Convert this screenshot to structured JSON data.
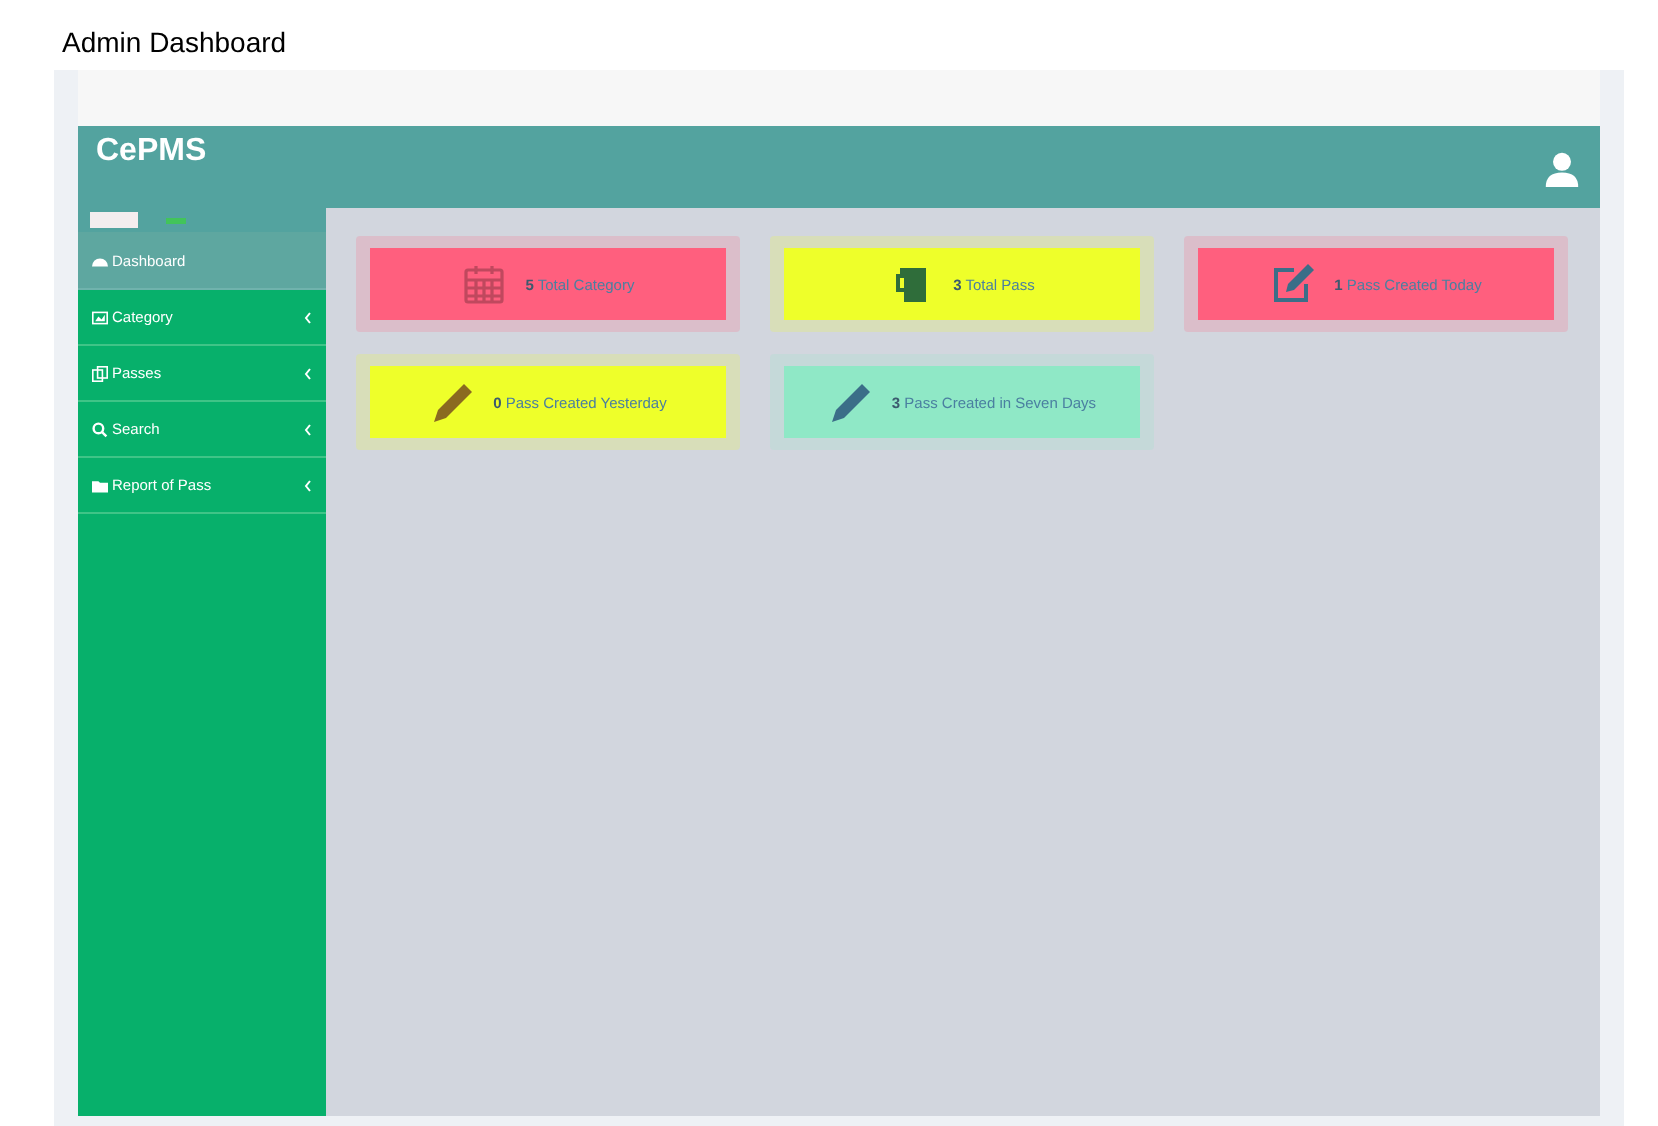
{
  "page_title": "Admin Dashboard",
  "header": {
    "brand": "CePMS"
  },
  "sidebar": {
    "items": [
      {
        "label": "Dashboard",
        "kind": "dashboard",
        "selected": true,
        "has_submenu": false
      },
      {
        "label": "Category",
        "kind": "image",
        "selected": false,
        "has_submenu": true
      },
      {
        "label": "Passes",
        "kind": "copy",
        "selected": false,
        "has_submenu": true
      },
      {
        "label": "Search",
        "kind": "search",
        "selected": false,
        "has_submenu": true
      },
      {
        "label": "Report of Pass",
        "kind": "folder",
        "selected": false,
        "has_submenu": true
      }
    ]
  },
  "cards": [
    {
      "count": "5",
      "label": "Total Category",
      "kind": "calendar",
      "color": "#ff5f7e"
    },
    {
      "count": "3",
      "label": "Total Pass",
      "kind": "mug",
      "color": "#eeff2a"
    },
    {
      "count": "1",
      "label": "Pass Created Today",
      "kind": "edit",
      "color": "#ff5f7e"
    },
    {
      "count": "0",
      "label": "Pass Created Yesterday",
      "kind": "pencil",
      "color": "#eeff2a"
    },
    {
      "count": "3",
      "label": "Pass Created in Seven Days",
      "kind": "pencil",
      "color": "#8fe8c6"
    }
  ]
}
